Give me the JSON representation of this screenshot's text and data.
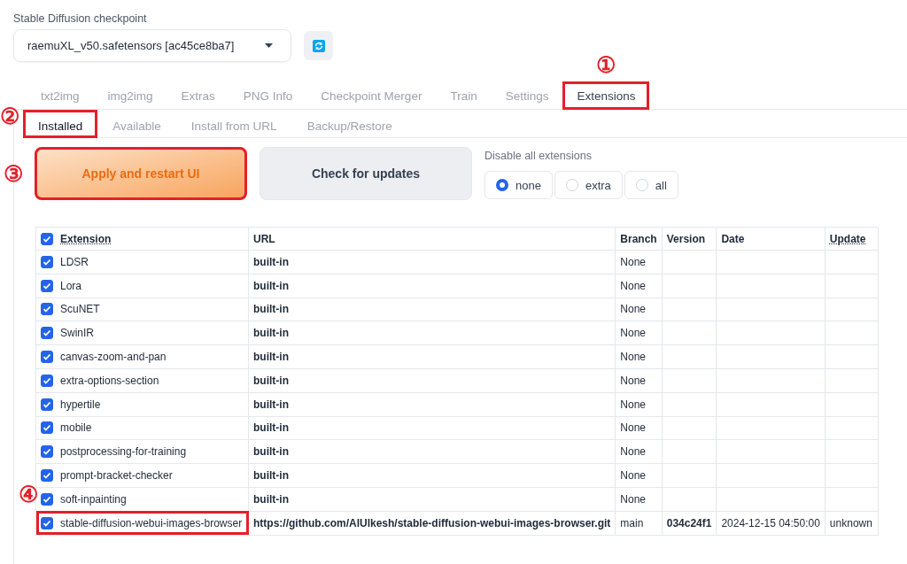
{
  "checkpoint": {
    "label": "Stable Diffusion checkpoint",
    "value": "raemuXL_v50.safetensors [ac45ce8ba7]"
  },
  "tabs": [
    {
      "label": "txt2img",
      "selected": false
    },
    {
      "label": "img2img",
      "selected": false
    },
    {
      "label": "Extras",
      "selected": false
    },
    {
      "label": "PNG Info",
      "selected": false
    },
    {
      "label": "Checkpoint Merger",
      "selected": false
    },
    {
      "label": "Train",
      "selected": false
    },
    {
      "label": "Settings",
      "selected": false
    },
    {
      "label": "Extensions",
      "selected": true,
      "callout": "①"
    }
  ],
  "subtabs": [
    {
      "label": "Installed",
      "selected": true,
      "callout": "②"
    },
    {
      "label": "Available",
      "selected": false
    },
    {
      "label": "Install from URL",
      "selected": false
    },
    {
      "label": "Backup/Restore",
      "selected": false
    }
  ],
  "buttons": [
    {
      "label": "Apply and restart UI",
      "kind": "primary",
      "callout": "③"
    },
    {
      "label": "Check for updates",
      "kind": "secondary"
    }
  ],
  "disable_all": {
    "label": "Disable all extensions",
    "options": [
      {
        "label": "none",
        "selected": true
      },
      {
        "label": "extra",
        "selected": false
      },
      {
        "label": "all",
        "selected": false
      }
    ]
  },
  "table": {
    "header_checked": true,
    "columns": [
      {
        "label": "Extension",
        "underlined": true
      },
      {
        "label": "URL",
        "underlined": false
      },
      {
        "label": "Branch",
        "underlined": false
      },
      {
        "label": "Version",
        "underlined": false
      },
      {
        "label": "Date",
        "underlined": false
      },
      {
        "label": "Update",
        "underlined": true
      }
    ],
    "rows": [
      {
        "checked": true,
        "name": "LDSR",
        "url": "built-in",
        "branch": "None",
        "version": "",
        "date": "",
        "update": ""
      },
      {
        "checked": true,
        "name": "Lora",
        "url": "built-in",
        "branch": "None",
        "version": "",
        "date": "",
        "update": ""
      },
      {
        "checked": true,
        "name": "ScuNET",
        "url": "built-in",
        "branch": "None",
        "version": "",
        "date": "",
        "update": ""
      },
      {
        "checked": true,
        "name": "SwinIR",
        "url": "built-in",
        "branch": "None",
        "version": "",
        "date": "",
        "update": ""
      },
      {
        "checked": true,
        "name": "canvas-zoom-and-pan",
        "url": "built-in",
        "branch": "None",
        "version": "",
        "date": "",
        "update": ""
      },
      {
        "checked": true,
        "name": "extra-options-section",
        "url": "built-in",
        "branch": "None",
        "version": "",
        "date": "",
        "update": ""
      },
      {
        "checked": true,
        "name": "hypertile",
        "url": "built-in",
        "branch": "None",
        "version": "",
        "date": "",
        "update": ""
      },
      {
        "checked": true,
        "name": "mobile",
        "url": "built-in",
        "branch": "None",
        "version": "",
        "date": "",
        "update": ""
      },
      {
        "checked": true,
        "name": "postprocessing-for-training",
        "url": "built-in",
        "branch": "None",
        "version": "",
        "date": "",
        "update": ""
      },
      {
        "checked": true,
        "name": "prompt-bracket-checker",
        "url": "built-in",
        "branch": "None",
        "version": "",
        "date": "",
        "update": ""
      },
      {
        "checked": true,
        "name": "soft-inpainting",
        "url": "built-in",
        "branch": "None",
        "version": "",
        "date": "",
        "update": ""
      },
      {
        "checked": true,
        "name": "stable-diffusion-webui-images-browser",
        "url": "https://github.com/AlUlkesh/stable-diffusion-webui-images-browser.git",
        "branch": "main",
        "version": "034c24f1",
        "date": "2024-12-15 04:50:00",
        "update": "unknown",
        "callout": "④"
      }
    ]
  }
}
